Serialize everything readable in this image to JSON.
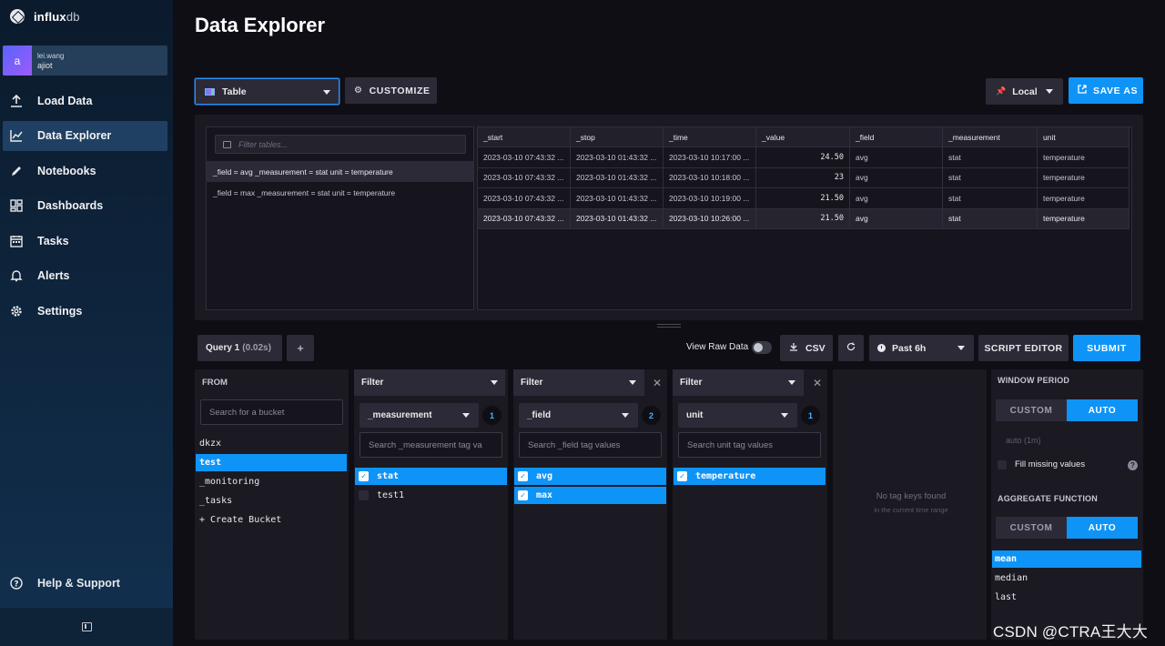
{
  "app": {
    "logo_bold": "influx",
    "logo_light": "db"
  },
  "user": {
    "initial": "a",
    "name": "lei.wang",
    "org": "ajiot"
  },
  "nav": {
    "items": [
      {
        "label": "Load Data",
        "icon": "upload-icon"
      },
      {
        "label": "Data Explorer",
        "icon": "graph-icon",
        "active": true
      },
      {
        "label": "Notebooks",
        "icon": "pencil-icon"
      },
      {
        "label": "Dashboards",
        "icon": "dashboard-grid-icon"
      },
      {
        "label": "Tasks",
        "icon": "calendar-icon"
      },
      {
        "label": "Alerts",
        "icon": "bell-icon"
      },
      {
        "label": "Settings",
        "icon": "gear-icon"
      }
    ],
    "help": "Help & Support"
  },
  "header": {
    "title": "Data Explorer",
    "graph_type": "Table",
    "customize": "CUSTOMIZE",
    "timezone": "Local",
    "save_as": "SAVE AS"
  },
  "tables_panel": {
    "filter_placeholder": "Filter tables...",
    "tables": [
      "_field = avg _measurement = stat unit = temperature",
      "_field = max _measurement = stat unit = temperature"
    ]
  },
  "results": {
    "columns": [
      "_start",
      "_stop",
      "_time",
      "_value",
      "_field",
      "_measurement",
      "unit"
    ],
    "rows": [
      [
        "2023-03-10 07:43:32 ...",
        "2023-03-10 01:43:32 ...",
        "2023-03-10 10:17:00 ...",
        "24.50",
        "avg",
        "stat",
        "temperature"
      ],
      [
        "2023-03-10 07:43:32 ...",
        "2023-03-10 01:43:32 ...",
        "2023-03-10 10:18:00 ...",
        "23",
        "avg",
        "stat",
        "temperature"
      ],
      [
        "2023-03-10 07:43:32 ...",
        "2023-03-10 01:43:32 ...",
        "2023-03-10 10:19:00 ...",
        "21.50",
        "avg",
        "stat",
        "temperature"
      ],
      [
        "2023-03-10 07:43:32 ...",
        "2023-03-10 01:43:32 ...",
        "2023-03-10 10:26:00 ...",
        "21.50",
        "avg",
        "stat",
        "temperature"
      ]
    ]
  },
  "query_bar": {
    "tab_label": "Query 1",
    "tab_time": "(0.02s)",
    "add": "+",
    "view_raw": "View Raw Data",
    "csv": "CSV",
    "time_range": "Past 6h",
    "script_editor": "SCRIPT EDITOR",
    "submit": "SUBMIT"
  },
  "from_card": {
    "label": "FROM",
    "search_placeholder": "Search for a bucket",
    "buckets": [
      "dkzx",
      "test",
      "_monitoring",
      "_tasks",
      "+ Create Bucket"
    ],
    "selected": "test"
  },
  "filters": [
    {
      "head": "Filter",
      "key": "_measurement",
      "count": "1",
      "search_placeholder": "Search _measurement tag va",
      "values": [
        {
          "label": "stat",
          "checked": true
        },
        {
          "label": "test1",
          "checked": false
        }
      ]
    },
    {
      "head": "Filter",
      "key": "_field",
      "count": "2",
      "search_placeholder": "Search _field tag values",
      "values": [
        {
          "label": "avg",
          "checked": true
        },
        {
          "label": "max",
          "checked": true
        }
      ]
    },
    {
      "head": "Filter",
      "key": "unit",
      "count": "1",
      "search_placeholder": "Search unit tag values",
      "values": [
        {
          "label": "temperature",
          "checked": true
        }
      ]
    }
  ],
  "empty_card": {
    "title": "No tag keys found",
    "subtitle": "in the current time range"
  },
  "window_card": {
    "window_period": "WINDOW PERIOD",
    "custom": "CUSTOM",
    "auto": "AUTO",
    "auto_hint": "auto (1m)",
    "fill_missing": "Fill missing values",
    "help": "?",
    "aggregate_function": "AGGREGATE FUNCTION",
    "functions": [
      "mean",
      "median",
      "last"
    ],
    "selected_function": "mean"
  },
  "watermark": "CSDN @CTRA王大大"
}
